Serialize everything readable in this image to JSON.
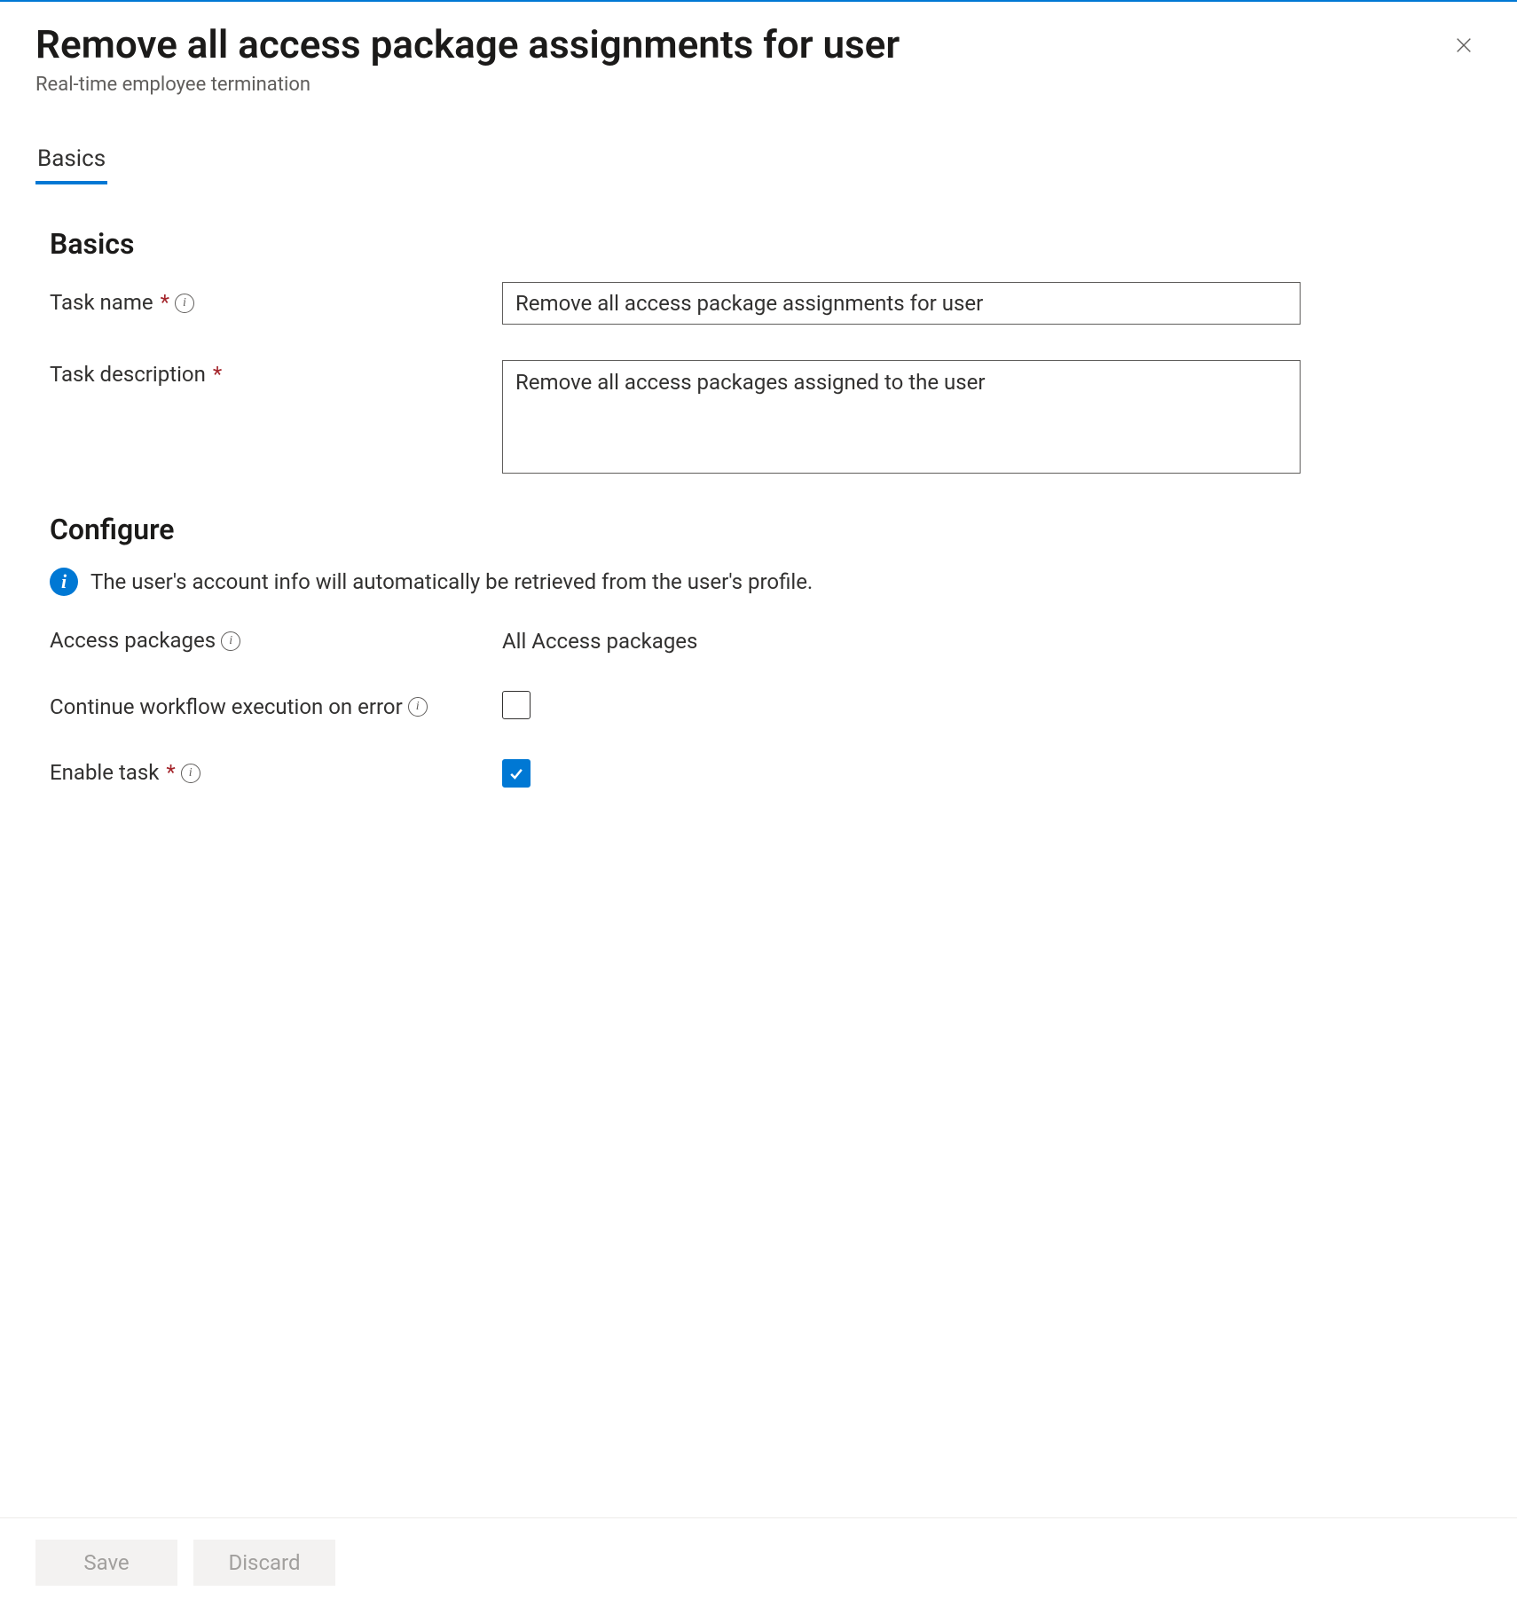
{
  "header": {
    "title": "Remove all access package assignments for user",
    "subtitle": "Real-time employee termination"
  },
  "tabs": {
    "basics": "Basics"
  },
  "sections": {
    "basics": "Basics",
    "configure": "Configure"
  },
  "form": {
    "task_name_label": "Task name",
    "task_name_value": "Remove all access package assignments for user",
    "task_description_label": "Task description",
    "task_description_value": "Remove all access packages assigned to the user",
    "info_banner": "The user's account info will automatically be retrieved from the user's profile.",
    "access_packages_label": "Access packages",
    "access_packages_value": "All Access packages",
    "continue_on_error_label": "Continue workflow execution on error",
    "continue_on_error_checked": false,
    "enable_task_label": "Enable task",
    "enable_task_checked": true
  },
  "footer": {
    "save": "Save",
    "discard": "Discard"
  }
}
